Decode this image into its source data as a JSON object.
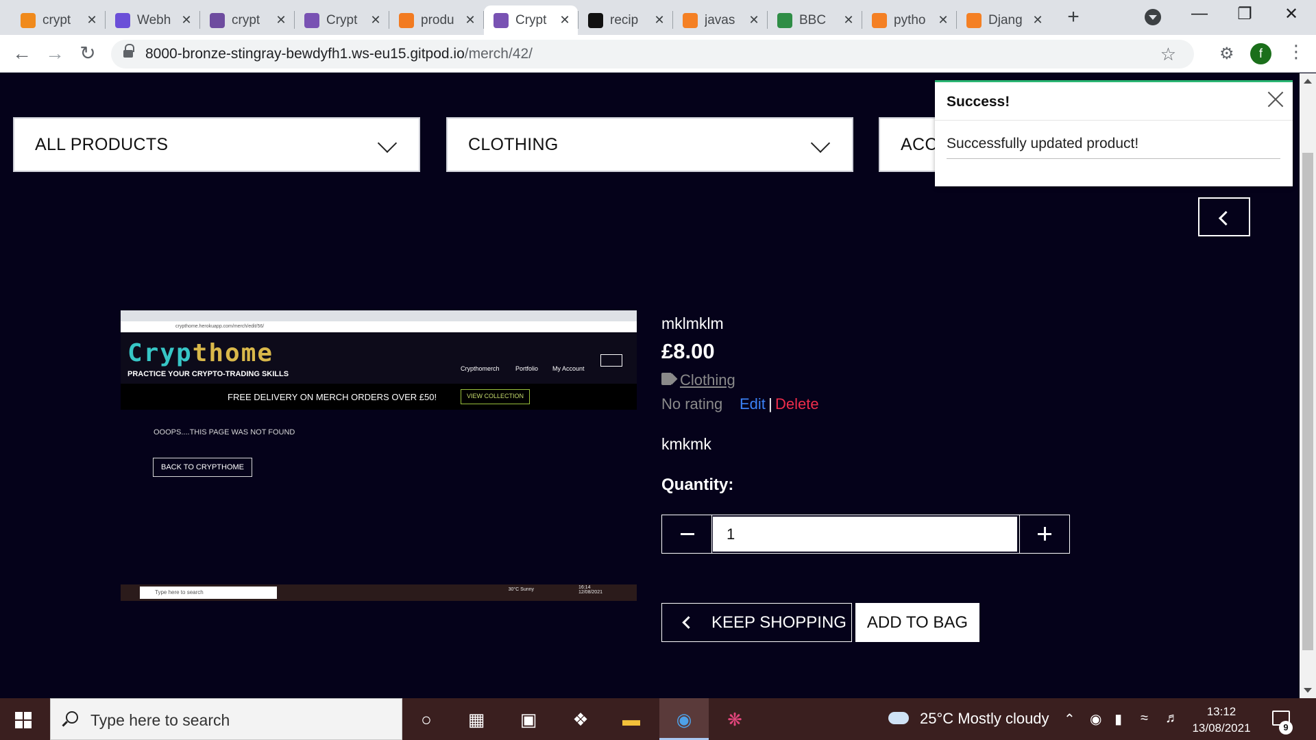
{
  "browser": {
    "tabs": [
      {
        "title": "crypt",
        "icon": "box-icon",
        "color": "#f08a1c",
        "active": false
      },
      {
        "title": "Webh",
        "icon": "s-logo-icon",
        "color": "#6b4fd8",
        "active": false
      },
      {
        "title": "crypt",
        "icon": "h-logo-icon",
        "color": "#6e4c9f",
        "active": false
      },
      {
        "title": "Crypt",
        "icon": "bootstrap-icon",
        "color": "#7952b3",
        "active": false
      },
      {
        "title": "produ",
        "icon": "g-logo-icon",
        "color": "#f27b21",
        "active": false
      },
      {
        "title": "Crypt",
        "icon": "bootstrap-icon",
        "color": "#7952b3",
        "active": true
      },
      {
        "title": "recip",
        "icon": "github-icon",
        "color": "#111111",
        "active": false
      },
      {
        "title": "javas",
        "icon": "stackoverflow-icon",
        "color": "#f48024",
        "active": false
      },
      {
        "title": "BBC",
        "icon": "gf-logo-icon",
        "color": "#2f8d46",
        "active": false
      },
      {
        "title": "pytho",
        "icon": "stackoverflow-icon",
        "color": "#f48024",
        "active": false
      },
      {
        "title": "Djang",
        "icon": "stackoverflow-icon",
        "color": "#f48024",
        "active": false
      }
    ],
    "url_host": "8000-bronze-stingray-bewdyfh1.ws-eu15.gitpod.io",
    "url_path": "/merch/42/",
    "profile_initial": "f"
  },
  "nav": {
    "dropdowns": [
      "ALL PRODUCTS",
      "CLOTHING",
      "ACC"
    ]
  },
  "toast": {
    "title": "Success!",
    "message": "Successfully updated product!"
  },
  "product": {
    "name": "mklmklm",
    "price": "£8.00",
    "category": "Clothing",
    "rating": "No rating",
    "edit_label": "Edit",
    "separator": "|",
    "delete_label": "Delete",
    "description": "kmkmk",
    "quantity_label": "Quantity:",
    "quantity_value": "1",
    "keep_shopping_label": "KEEP SHOPPING",
    "add_to_bag_label": "ADD TO BAG"
  },
  "product_image": {
    "url": "crypthome.herokuapp.com/merch/edit/56/",
    "logo_a": "Cryp",
    "logo_b": "thome",
    "tagline": "PRACTICE YOUR CRYPTO-TRADING SKILLS",
    "nav": [
      "Crypthomerch",
      "Portfolio",
      "My Account"
    ],
    "banner": "FREE DELIVERY ON MERCH ORDERS OVER £50!",
    "banner_button": "VIEW COLLECTION",
    "not_found": "OOOPS....THIS PAGE WAS NOT FOUND",
    "back_button": "BACK TO CRYPTHOME",
    "taskbar_search": "Type here to search",
    "taskbar_weather": "30°C  Sunny",
    "taskbar_clock": "16:14\n12/08/2021"
  },
  "taskbar": {
    "search_placeholder": "Type here to search",
    "weather": "25°C  Mostly cloudy",
    "time": "13:12",
    "date": "13/08/2021",
    "notification_count": "9"
  },
  "colors": {
    "page_bg": "#05021a",
    "delete": "#ef2d4b",
    "edit": "#3b82f6",
    "toast_accent": "#2bb673"
  }
}
